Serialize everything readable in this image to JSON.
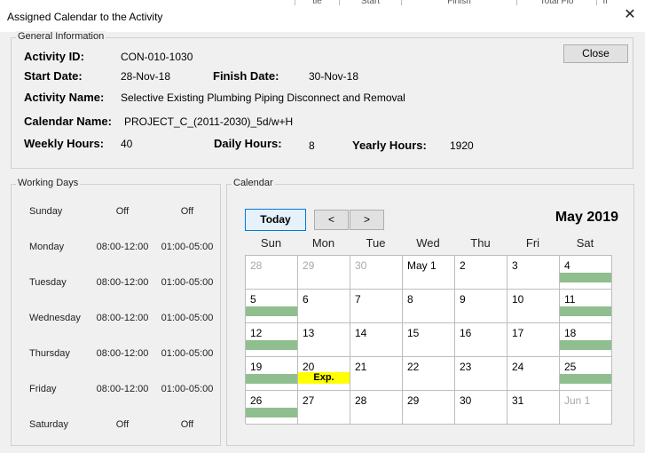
{
  "window": {
    "title": "Assigned Calendar to the Activity",
    "close_glyph": "✕",
    "bg_peek": [
      "tle",
      "Start",
      "Finish",
      "Total Flo",
      "fr"
    ]
  },
  "general": {
    "title": "General Information",
    "close_button": "Close",
    "activity_id_label": "Activity ID:",
    "activity_id": "CON-010-1030",
    "start_label": "Start Date:",
    "start": "28-Nov-18",
    "finish_label": "Finish Date:",
    "finish": "30-Nov-18",
    "activity_name_label": "Activity Name:",
    "activity_name": "Selective Existing Plumbing Piping Disconnect and Removal",
    "calendar_name_label": "Calendar Name:",
    "calendar_name": "PROJECT_C_(2011-2030)_5d/w+H",
    "weekly_label": "Weekly Hours:",
    "weekly": "40",
    "daily_label": "Daily Hours:",
    "daily": "8",
    "yearly_label": "Yearly Hours:",
    "yearly": "1920"
  },
  "working_days": {
    "title": "Working Days",
    "rows": [
      {
        "day": "Sunday",
        "am": "Off",
        "pm": "Off"
      },
      {
        "day": "Monday",
        "am": "08:00-12:00",
        "pm": "01:00-05:00"
      },
      {
        "day": "Tuesday",
        "am": "08:00-12:00",
        "pm": "01:00-05:00"
      },
      {
        "day": "Wednesday",
        "am": "08:00-12:00",
        "pm": "01:00-05:00"
      },
      {
        "day": "Thursday",
        "am": "08:00-12:00",
        "pm": "01:00-05:00"
      },
      {
        "day": "Friday",
        "am": "08:00-12:00",
        "pm": "01:00-05:00"
      },
      {
        "day": "Saturday",
        "am": "Off",
        "pm": "Off"
      }
    ]
  },
  "calendar": {
    "title": "Calendar",
    "today_button": "Today",
    "prev_button": "<",
    "next_button": ">",
    "month_label": "May 2019",
    "weekdays": [
      "Sun",
      "Mon",
      "Tue",
      "Wed",
      "Thu",
      "Fri",
      "Sat"
    ],
    "colors": {
      "nonwork_bar": "#8fbf8f",
      "exp_marker": "#ffff00"
    },
    "weeks": [
      [
        {
          "d": "28",
          "dim": true
        },
        {
          "d": "29",
          "dim": true
        },
        {
          "d": "30",
          "dim": true
        },
        {
          "d": "May 1"
        },
        {
          "d": "2"
        },
        {
          "d": "3"
        },
        {
          "d": "4",
          "bar": true
        }
      ],
      [
        {
          "d": "5",
          "bar": true
        },
        {
          "d": "6"
        },
        {
          "d": "7"
        },
        {
          "d": "8"
        },
        {
          "d": "9"
        },
        {
          "d": "10"
        },
        {
          "d": "11",
          "bar": true
        }
      ],
      [
        {
          "d": "12",
          "bar": true
        },
        {
          "d": "13"
        },
        {
          "d": "14"
        },
        {
          "d": "15"
        },
        {
          "d": "16"
        },
        {
          "d": "17"
        },
        {
          "d": "18",
          "bar": true
        }
      ],
      [
        {
          "d": "19",
          "bar": true
        },
        {
          "d": "20",
          "exp": "Exp."
        },
        {
          "d": "21"
        },
        {
          "d": "22"
        },
        {
          "d": "23"
        },
        {
          "d": "24"
        },
        {
          "d": "25",
          "bar": true
        }
      ],
      [
        {
          "d": "26",
          "bar": true
        },
        {
          "d": "27"
        },
        {
          "d": "28"
        },
        {
          "d": "29"
        },
        {
          "d": "30"
        },
        {
          "d": "31"
        },
        {
          "d": "Jun 1",
          "dim": true
        }
      ]
    ]
  }
}
